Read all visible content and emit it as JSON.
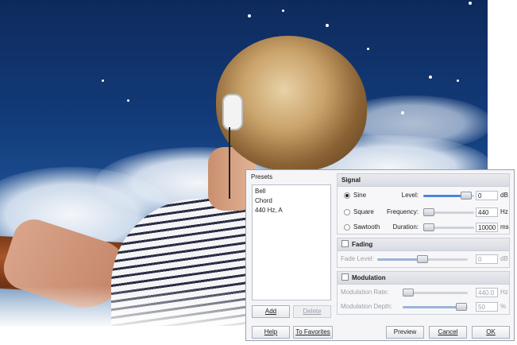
{
  "presets": {
    "label": "Presets",
    "items": [
      "Bell",
      "Chord",
      "440 Hz, A"
    ],
    "add_label": "Add",
    "delete_label": "Delete"
  },
  "signal": {
    "title": "Signal",
    "waveforms": [
      {
        "label": "Sine",
        "selected": true
      },
      {
        "label": "Square",
        "selected": false
      },
      {
        "label": "Sawtooth",
        "selected": false
      }
    ],
    "level": {
      "label": "Level:",
      "value": "0",
      "unit": "dB",
      "fraction": 0.85
    },
    "frequency": {
      "label": "Frequency:",
      "value": "440",
      "unit": "Hz",
      "fraction": 0.0
    },
    "duration": {
      "label": "Duration:",
      "value": "10000",
      "unit": "ms",
      "fraction": 0.0
    }
  },
  "fading": {
    "title": "Fading",
    "checked": false,
    "level": {
      "label": "Fade Level:",
      "value": "0",
      "unit": "dB",
      "fraction": 0.5
    }
  },
  "modulation": {
    "title": "Modulation",
    "checked": false,
    "rate": {
      "label": "Modulation Rate:",
      "value": "440.0",
      "unit": "Hz",
      "fraction": 0.0
    },
    "depth": {
      "label": "Modulation Depth:",
      "value": "50",
      "unit": "%",
      "fraction": 0.9
    }
  },
  "footer": {
    "help_label": "Help",
    "favorites_label": "To Favorites",
    "preview_label": "Preview",
    "cancel_label": "Cancel",
    "ok_label": "OK"
  },
  "colors": {
    "accent": "#4d86d6",
    "accent_disabled": "#9cb4d8"
  }
}
